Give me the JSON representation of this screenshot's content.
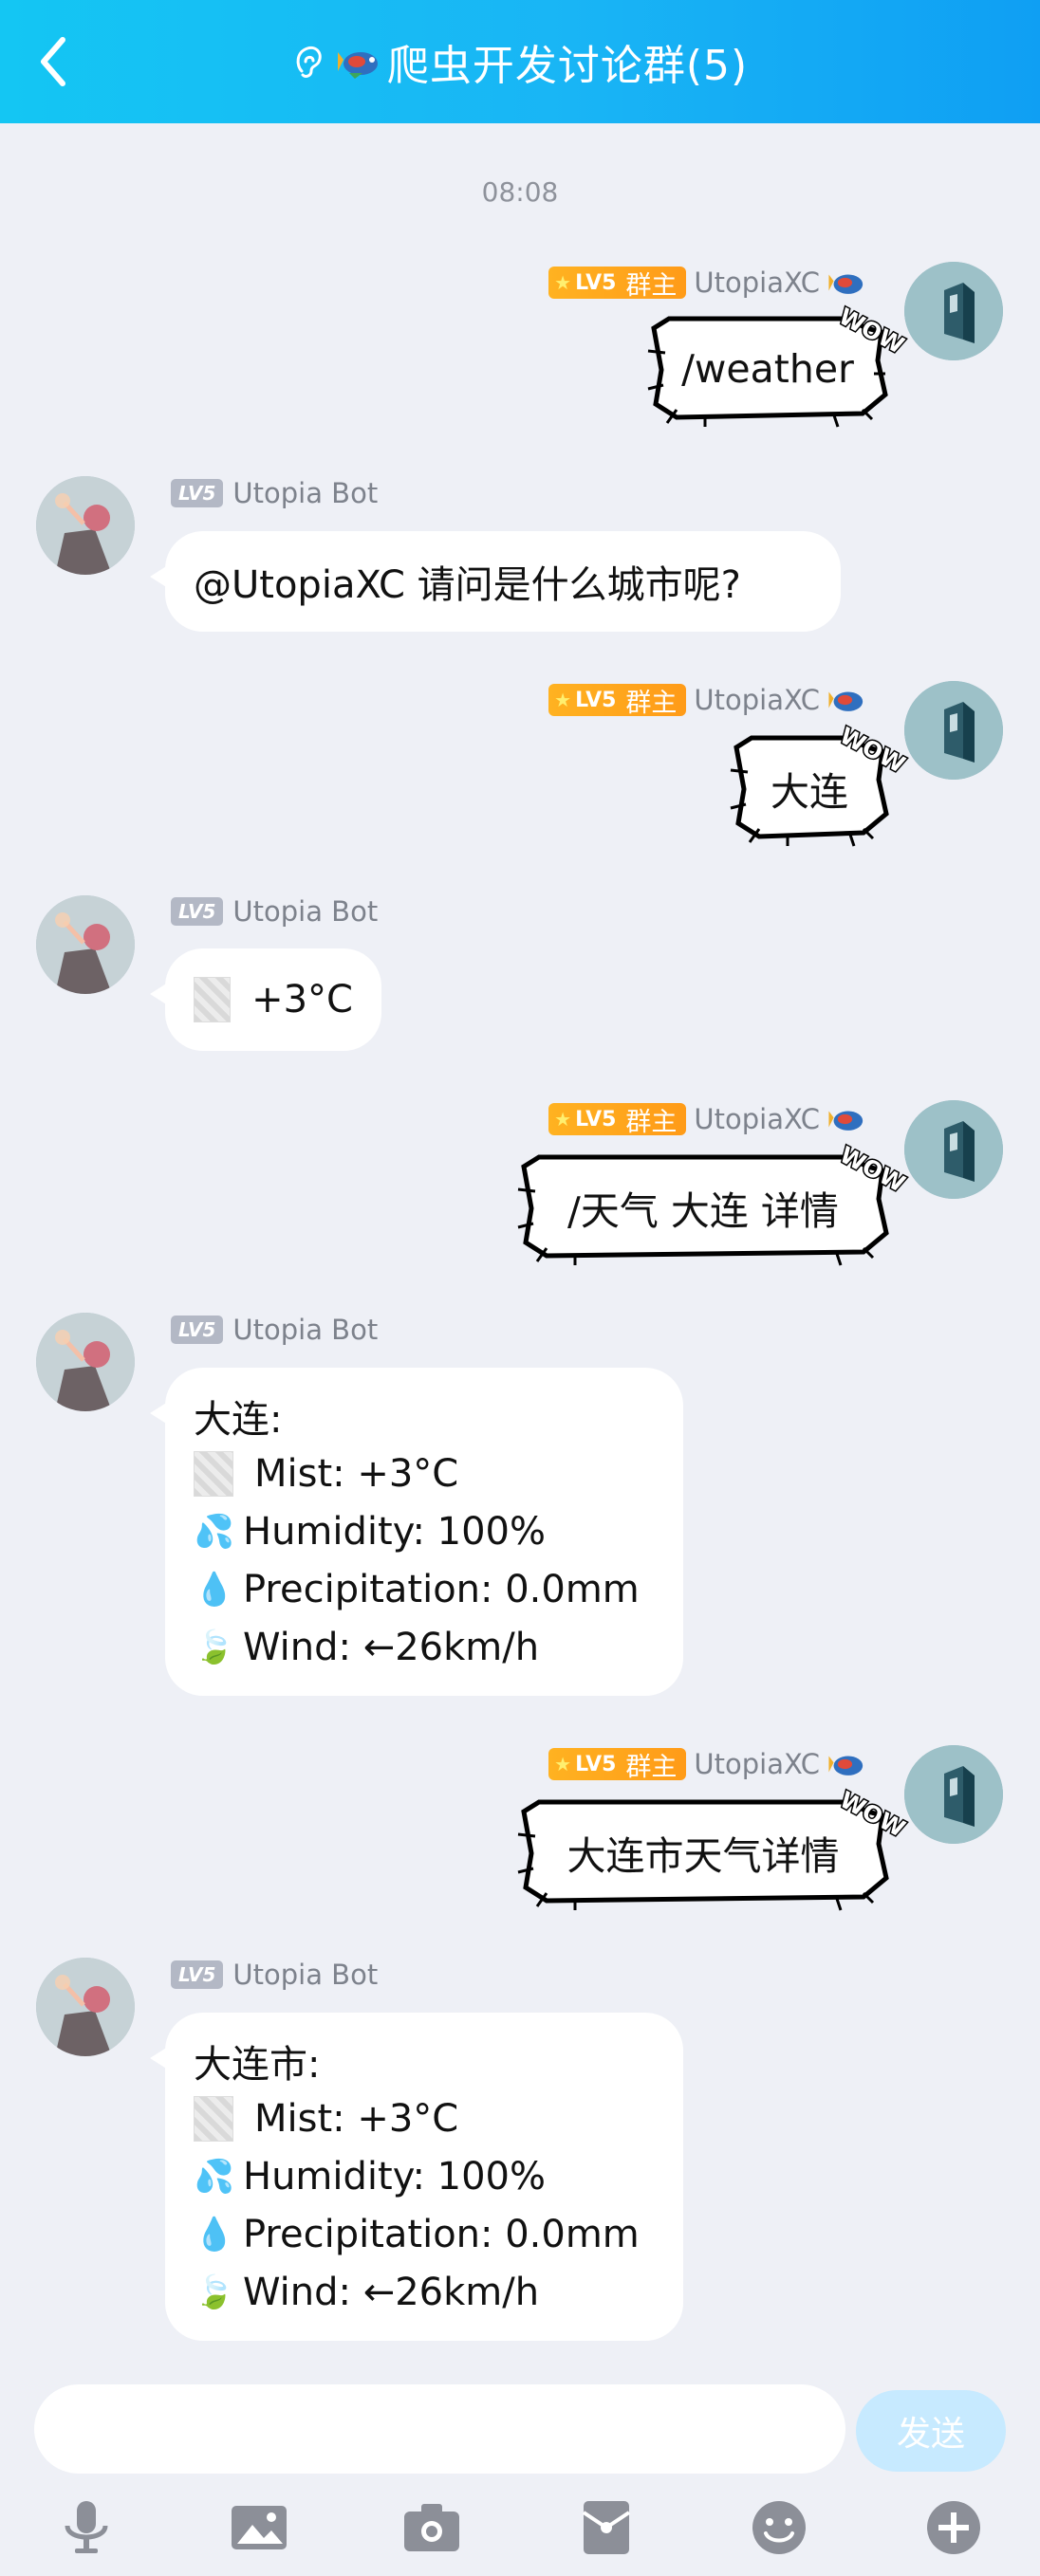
{
  "header": {
    "title": "爬虫开发讨论群(5)"
  },
  "timestamp": "08:08",
  "self": {
    "name": "UtopiaXC",
    "level": "LV5",
    "role": "群主"
  },
  "bot": {
    "name": "Utopia Bot",
    "level": "LV5"
  },
  "messages": [
    {
      "from": "self",
      "text": "/weather"
    },
    {
      "from": "bot",
      "lines": [
        "@UtopiaXC  请问是什么城市呢?"
      ]
    },
    {
      "from": "self",
      "text": "大连"
    },
    {
      "from": "bot",
      "lines": [
        "+3°C"
      ]
    },
    {
      "from": "self",
      "text": "/天气 大连 详情"
    },
    {
      "from": "bot",
      "lines": [
        "大连:",
        "Mist: +3°C",
        "Humidity: 100%",
        "Precipitation: 0.0mm",
        "Wind: ←26km/h"
      ]
    },
    {
      "from": "self",
      "text": "大连市天气详情"
    },
    {
      "from": "bot",
      "lines": [
        "大连市:",
        "Mist: +3°C",
        "Humidity: 100%",
        "Precipitation: 0.0mm",
        "Wind: ←26km/h"
      ]
    }
  ],
  "comic_sticker": "WOW",
  "input": {
    "placeholder": "",
    "send_label": "发送"
  },
  "toolbar": {
    "icons": [
      "microphone-icon",
      "image-icon",
      "camera-icon",
      "red-packet-icon",
      "emoji-icon",
      "plus-icon"
    ]
  },
  "colors": {
    "header": "#16b9f5",
    "background": "#eef0f6",
    "badge": "#ffa81c",
    "send_disabled": "#c7eaff"
  }
}
